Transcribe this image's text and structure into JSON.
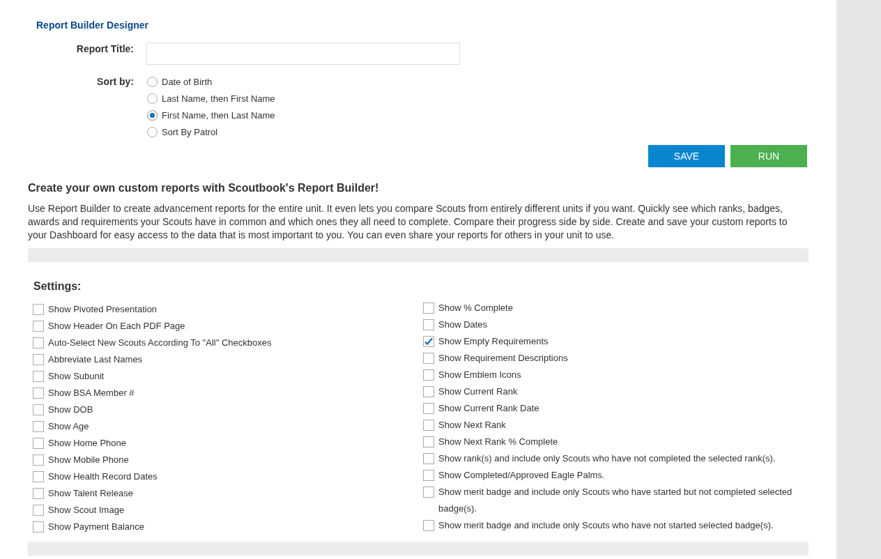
{
  "title": "Report Builder Designer",
  "report_title": {
    "label": "Report Title:"
  },
  "sort": {
    "label": "Sort by:",
    "options": [
      {
        "label": "Date of Birth",
        "selected": false
      },
      {
        "label": "Last Name, then First Name",
        "selected": false
      },
      {
        "label": "First Name, then Last Name",
        "selected": true
      },
      {
        "label": "Sort By Patrol",
        "selected": false
      }
    ]
  },
  "buttons": [
    {
      "label": "SAVE",
      "kind": "save"
    },
    {
      "label": "RUN",
      "kind": "run"
    }
  ],
  "intro": {
    "heading": "Create your own custom reports with Scoutbook's Report Builder!",
    "text": "Use Report Builder to create advancement reports for the entire unit. It even lets you compare Scouts from entirely different units if you want. Quickly see which ranks, badges, awards and requirements your Scouts have in common and which ones they all need to complete. Compare their progress side by side. Create and save your custom reports to your Dashboard for easy access to the data that is most important to you. You can even share your reports for others in your unit to use."
  },
  "settings": {
    "heading": "Settings:",
    "left": [
      {
        "label": "Show Pivoted Presentation",
        "checked": false
      },
      {
        "label": "Show Header On Each PDF Page",
        "checked": false
      },
      {
        "label": "Auto-Select New Scouts According To \"All\" Checkboxes",
        "checked": false
      },
      {
        "label": "Abbreviate Last Names",
        "checked": false
      },
      {
        "label": "Show Subunit",
        "checked": false
      },
      {
        "label": "Show BSA Member #",
        "checked": false
      },
      {
        "label": "Show DOB",
        "checked": false
      },
      {
        "label": "Show Age",
        "checked": false
      },
      {
        "label": "Show Home Phone",
        "checked": false
      },
      {
        "label": "Show Mobile Phone",
        "checked": false
      },
      {
        "label": "Show Health Record Dates",
        "checked": false
      },
      {
        "label": "Show Talent Release",
        "checked": false
      },
      {
        "label": "Show Scout Image",
        "checked": false
      },
      {
        "label": "Show Payment Balance",
        "checked": false
      }
    ],
    "right": [
      {
        "label": "Show % Complete",
        "checked": false
      },
      {
        "label": "Show Dates",
        "checked": false
      },
      {
        "label": "Show Empty Requirements",
        "checked": true
      },
      {
        "label": "Show Requirement Descriptions",
        "checked": false
      },
      {
        "label": "Show Emblem Icons",
        "checked": false
      },
      {
        "label": "Show Current Rank",
        "checked": false
      },
      {
        "label": "Show Current Rank Date",
        "checked": false
      },
      {
        "label": "Show Next Rank",
        "checked": false
      },
      {
        "label": "Show Next Rank % Complete",
        "checked": false
      },
      {
        "label": "Show rank(s) and include only Scouts who have not completed the selected rank(s).",
        "checked": false
      },
      {
        "label": "Show Completed/Approved Eagle Palms.",
        "checked": false
      },
      {
        "label": "Show merit badge and include only Scouts who have started but not completed selected badge(s).",
        "checked": false
      },
      {
        "label": "Show merit badge and include only Scouts who have not started selected badge(s).",
        "checked": false
      }
    ]
  }
}
